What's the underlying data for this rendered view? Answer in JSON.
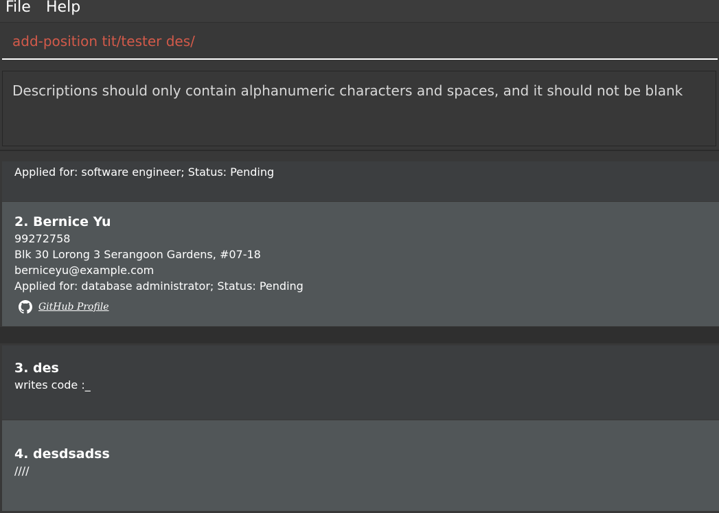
{
  "menu": {
    "file_label": "File",
    "help_label": "Help"
  },
  "command": {
    "value": "add-position tit/tester des/"
  },
  "result": {
    "message": "Descriptions should only contain alphanumeric characters and spaces, and it should not be blank"
  },
  "persons": {
    "partial_card": {
      "applied_line": "Applied for: software engineer; Status: Pending"
    },
    "items": [
      {
        "index_title": "2.  Bernice Yu",
        "phone": "99272758",
        "address": "Blk 30 Lorong 3 Serangoon Gardens, #07-18",
        "email": "berniceyu@example.com",
        "applied_line": "Applied for: database administrator; Status: Pending",
        "github_label": "GitHub Profile",
        "github_icon": "github-icon"
      }
    ]
  },
  "positions": {
    "items": [
      {
        "index_title": "3.  des",
        "description": "writes code :_"
      },
      {
        "index_title": "4.  desdsadss",
        "description": "////"
      }
    ]
  },
  "colors": {
    "command_text": "#d35a4a",
    "card_dark": "#3c3e40",
    "card_light": "#515658",
    "background": "#383838"
  }
}
